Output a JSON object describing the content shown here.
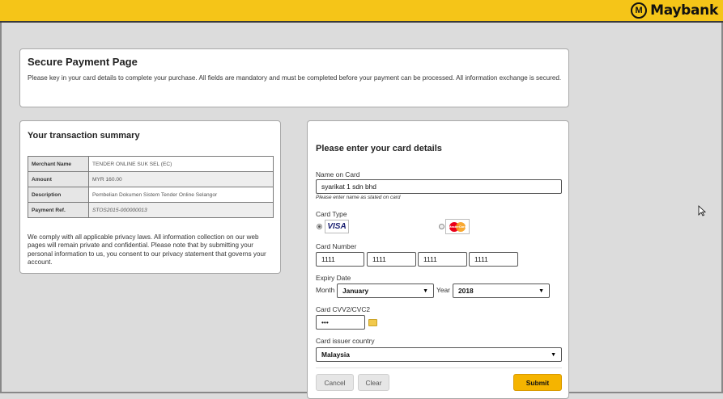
{
  "brand": {
    "name": "Maybank"
  },
  "intro": {
    "title": "Secure Payment Page",
    "text": "Please key in your card details to complete your purchase. All fields are mandatory and must be completed before your payment can be processed. All information exchange is secured."
  },
  "summary": {
    "title": "Your transaction summary",
    "rows": [
      {
        "label": "Merchant Name",
        "value": "TENDER ONLINE SUK SEL (EC)"
      },
      {
        "label": "Amount",
        "value": "MYR 160.00"
      },
      {
        "label": "Description",
        "value": "Pembelian Dokumen Sistem Tender Online Selangor"
      },
      {
        "label": "Payment Ref.",
        "value": "STOS2015-000000013"
      }
    ],
    "privacy": "We comply with all applicable privacy laws. All information collection on our web pages will remain private and confidential. Please note that by submitting your personal information to us, you consent to our privacy statement that governs your account."
  },
  "card": {
    "title": "Please enter your card details",
    "name_label": "Name on Card",
    "name_value": "syarikat 1 sdn bhd",
    "name_hint": "Please enter name as stated on card",
    "type_label": "Card Type",
    "type_selected": "VISA",
    "visa_text": "VISA",
    "mc_text": "MasterCard",
    "number_label": "Card Number",
    "number_parts": [
      "1111",
      "1111",
      "1111",
      "1111"
    ],
    "expiry_label": "Expiry Date",
    "month_label": "Month",
    "month_value": "January",
    "year_label": "Year",
    "year_value": "2018",
    "cvv_label": "Card CVV2/CVC2",
    "cvv_value": "•••",
    "country_label": "Card issuer country",
    "country_value": "Malaysia",
    "cancel_label": "Cancel",
    "clear_label": "Clear",
    "submit_label": "Submit"
  },
  "colors": {
    "brand_yellow": "#f5c518",
    "submit": "#f5b400"
  }
}
